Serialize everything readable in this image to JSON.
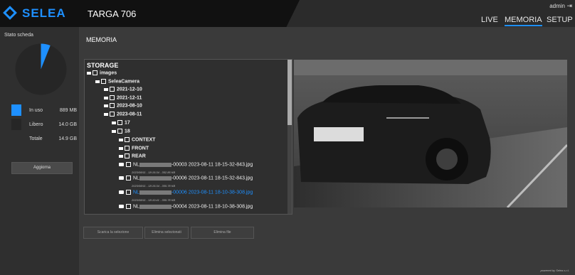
{
  "header": {
    "brand": "SELEA",
    "device_name": "TARGA 706",
    "user": "admin",
    "nav": [
      "LIVE",
      "MEMORIA",
      "SETUP"
    ],
    "active_nav": "MEMORIA"
  },
  "sidebar": {
    "title": "Stato scheda",
    "used_fraction": 0.06,
    "legend": [
      {
        "label": "In uso",
        "value": "889 MB",
        "color": "#1e90ff"
      },
      {
        "label": "Libero",
        "value": "14.0 GB",
        "color": "#262626"
      },
      {
        "label": "Totale",
        "value": "14.9 GB",
        "color": ""
      }
    ],
    "update_label": "Aggiorna"
  },
  "main": {
    "section_title": "MEMORIA",
    "tree": {
      "root": "STORAGE",
      "folders": [
        "images",
        "SeleaCamera",
        "2021-12-10",
        "2021-12-11",
        "2023-08-10",
        "2023-08-11",
        "17",
        "18",
        "CONTEXT",
        "FRONT",
        "REAR"
      ],
      "files": [
        {
          "prefix": "NL",
          "name": "-00003 2023-08-11 18-15-32-843.jpg",
          "meta": "2023/08/11 - 18:15:34 - 352.85 KB",
          "selected": false
        },
        {
          "prefix": "NL",
          "name": "-00006 2023-08-11 18-15-32-843.jpg",
          "meta": "2023/08/11 - 18:15:34 - 355.78 KB",
          "selected": false
        },
        {
          "prefix": "NL",
          "name": "-00006 2023-08-11 18-10-38-308.jpg",
          "meta": "2023/08/11 - 18:10:41 - 355.78 KB",
          "selected": true
        },
        {
          "prefix": "NL",
          "name": "-00004 2023-08-11 18-10-38-308.jpg",
          "meta": "",
          "selected": false
        }
      ]
    },
    "actions": [
      "Scarica la selezione",
      "Elimina selezionati",
      "Elimina file"
    ],
    "footer": "powered by Selea s.r.l."
  },
  "colors": {
    "accent": "#1e90ff"
  }
}
